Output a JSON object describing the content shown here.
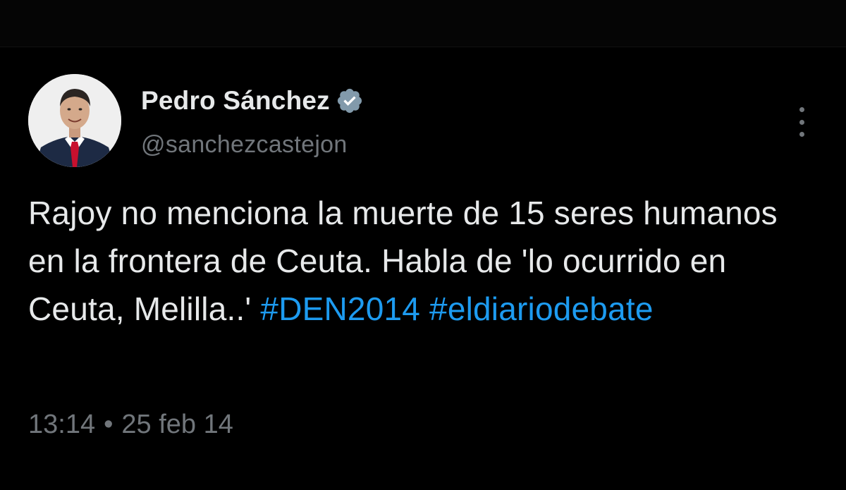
{
  "tweet": {
    "author": {
      "display_name": "Pedro Sánchez",
      "handle": "@sanchezcastejon",
      "verified_icon": "verified-badge-icon",
      "avatar_icon": "avatar-photo"
    },
    "more_icon": "more-options-icon",
    "text": {
      "part1": "Rajoy no menciona la muerte de 15 seres humanos en la frontera de Ceuta. Habla de 'lo ocurrido en Ceuta, Melilla..' ",
      "hashtag1": "#DEN2014",
      "hashtag2": "#eldiariodebate"
    },
    "time": "13:14",
    "separator": "•",
    "date": "25 feb 14"
  },
  "colors": {
    "background": "#000000",
    "text": "#e7e9ea",
    "secondary": "#71767b",
    "link": "#1d9bf0",
    "verified": "#829aab"
  }
}
